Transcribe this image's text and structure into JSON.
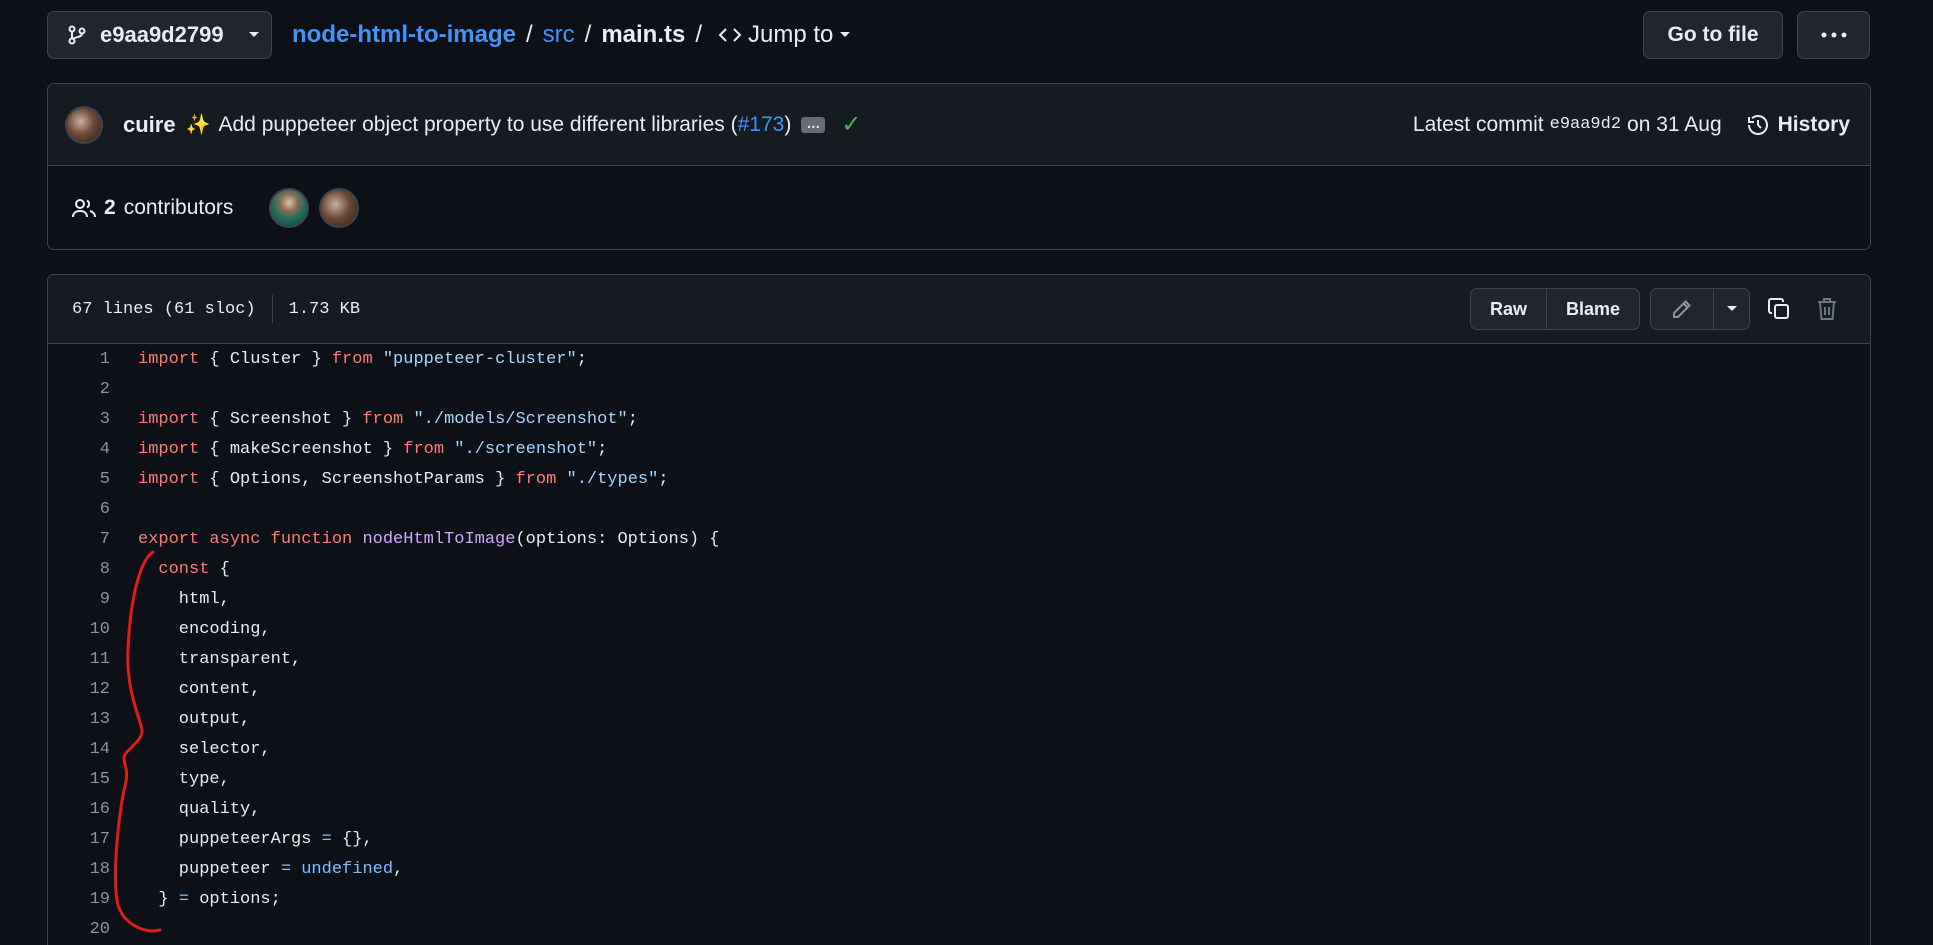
{
  "topbar": {
    "branch": "e9aa9d2799",
    "repo": "node-html-to-image",
    "folder": "src",
    "file": "main.ts",
    "jump_to": "Jump to",
    "goto_file": "Go to file"
  },
  "commit": {
    "author": "cuire",
    "message_prefix": "Add puppeteer object property to use different libraries (",
    "pr": "#173",
    "message_suffix": ")",
    "ellipsis": "…",
    "latest_label": "Latest commit",
    "sha": "e9aa9d2",
    "date": "on 31 Aug",
    "history": "History"
  },
  "contributors": {
    "count": "2",
    "label": "contributors"
  },
  "file": {
    "lines_info": "67 lines (61 sloc)",
    "size": "1.73 KB",
    "raw": "Raw",
    "blame": "Blame"
  },
  "code": {
    "lines": [
      {
        "n": "1",
        "tokens": [
          [
            "kw",
            "import"
          ],
          [
            "",
            "{ Cluster } "
          ],
          [
            "kw",
            "from"
          ],
          [
            "",
            ""
          ],
          [
            "str",
            " \"puppeteer-cluster\""
          ],
          [
            "",
            ";"
          ]
        ]
      },
      {
        "n": "2",
        "tokens": []
      },
      {
        "n": "3",
        "tokens": [
          [
            "kw",
            "import"
          ],
          [
            "",
            "{ Screenshot } "
          ],
          [
            "kw",
            "from"
          ],
          [
            "str",
            " \"./models/Screenshot\""
          ],
          [
            "",
            ";"
          ]
        ]
      },
      {
        "n": "4",
        "tokens": [
          [
            "kw",
            "import"
          ],
          [
            "",
            "{ makeScreenshot } "
          ],
          [
            "kw",
            "from"
          ],
          [
            "str",
            " \"./screenshot\""
          ],
          [
            "",
            ";"
          ]
        ]
      },
      {
        "n": "5",
        "tokens": [
          [
            "kw",
            "import"
          ],
          [
            "",
            "{ Options, ScreenshotParams } "
          ],
          [
            "kw",
            "from"
          ],
          [
            "str",
            " \"./types\""
          ],
          [
            "",
            ";"
          ]
        ]
      },
      {
        "n": "6",
        "tokens": []
      },
      {
        "n": "7",
        "tokens": [
          [
            "kw",
            "export async function "
          ],
          [
            "fn",
            "nodeHtmlToImage"
          ],
          [
            "",
            "(options: Options) {"
          ]
        ]
      },
      {
        "n": "8",
        "tokens": [
          [
            "",
            "  "
          ],
          [
            "kw",
            "const"
          ],
          [
            "",
            " {"
          ]
        ]
      },
      {
        "n": "9",
        "tokens": [
          [
            "",
            "    html,"
          ]
        ]
      },
      {
        "n": "10",
        "tokens": [
          [
            "",
            "    encoding,"
          ]
        ]
      },
      {
        "n": "11",
        "tokens": [
          [
            "",
            "    transparent,"
          ]
        ]
      },
      {
        "n": "12",
        "tokens": [
          [
            "",
            "    content,"
          ]
        ]
      },
      {
        "n": "13",
        "tokens": [
          [
            "",
            "    output,"
          ]
        ]
      },
      {
        "n": "14",
        "tokens": [
          [
            "",
            "    selector,"
          ]
        ]
      },
      {
        "n": "15",
        "tokens": [
          [
            "",
            "    type,"
          ]
        ]
      },
      {
        "n": "16",
        "tokens": [
          [
            "",
            "    quality,"
          ]
        ]
      },
      {
        "n": "17",
        "tokens": [
          [
            "",
            "    puppeteerArgs "
          ],
          [
            "cst",
            "="
          ],
          [
            "",
            " {},"
          ]
        ]
      },
      {
        "n": "18",
        "tokens": [
          [
            "",
            "    puppeteer "
          ],
          [
            "cst",
            "="
          ],
          [
            "cst",
            " undefined"
          ],
          [
            "",
            ","
          ]
        ]
      },
      {
        "n": "19",
        "tokens": [
          [
            "",
            "  } "
          ],
          [
            "cst",
            "="
          ],
          [
            "",
            " options;"
          ]
        ]
      },
      {
        "n": "20",
        "tokens": []
      }
    ]
  },
  "colors": {
    "background": "#0d1117",
    "link": "#4493f8",
    "keyword": "#ff7b72",
    "string": "#a5d6ff",
    "function": "#d2a8ff",
    "constant": "#79c0ff",
    "annotation": "#e01b1b",
    "check": "#3fb950"
  }
}
